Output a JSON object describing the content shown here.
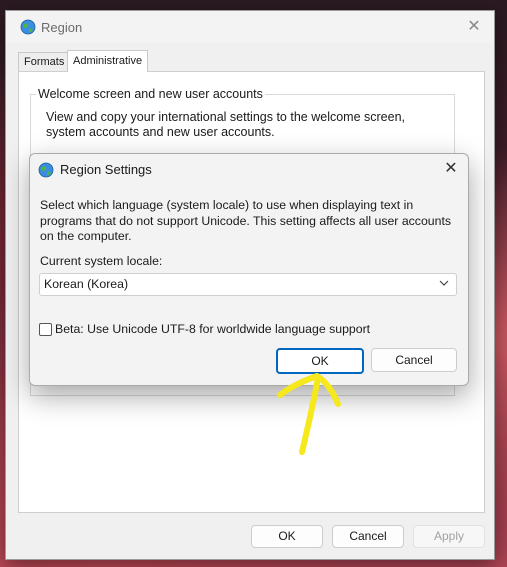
{
  "window": {
    "title": "Region",
    "close_glyph": "✕",
    "tabs": [
      {
        "label": "Formats",
        "selected": false
      },
      {
        "label": "Administrative",
        "selected": true
      }
    ],
    "group": {
      "legend": "Welcome screen and new user accounts",
      "description": "View and copy your international settings to the welcome screen, system accounts and new user accounts."
    },
    "buttons": {
      "ok": "OK",
      "cancel": "Cancel",
      "apply": "Apply"
    }
  },
  "dialog": {
    "title": "Region Settings",
    "close_glyph": "✕",
    "description": "Select which language (system locale) to use when displaying text in programs that do not support Unicode. This setting affects all user accounts on the computer.",
    "locale_label": "Current system locale:",
    "locale_value": "Korean (Korea)",
    "utf8_checkbox_label": "Beta: Use Unicode UTF-8 for worldwide language support",
    "utf8_checked": false,
    "buttons": {
      "ok": "OK",
      "cancel": "Cancel"
    }
  },
  "icons": {
    "app": "globe-icon",
    "dropdown": "chevron-down-icon",
    "annotation": "arrow-up-annotation"
  },
  "colors": {
    "accent": "#0067c0",
    "annotation": "#f5e81c"
  }
}
